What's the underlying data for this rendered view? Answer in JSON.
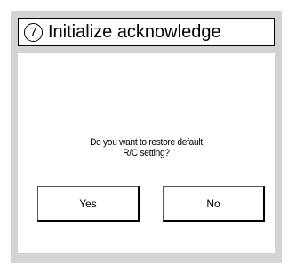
{
  "title": {
    "number": "7",
    "text": "Initialize acknowledge"
  },
  "dialog": {
    "message_line1": "Do you want to restore default",
    "message_line2": "R/C setting?"
  },
  "buttons": {
    "yes_label": "Yes",
    "no_label": "No"
  }
}
